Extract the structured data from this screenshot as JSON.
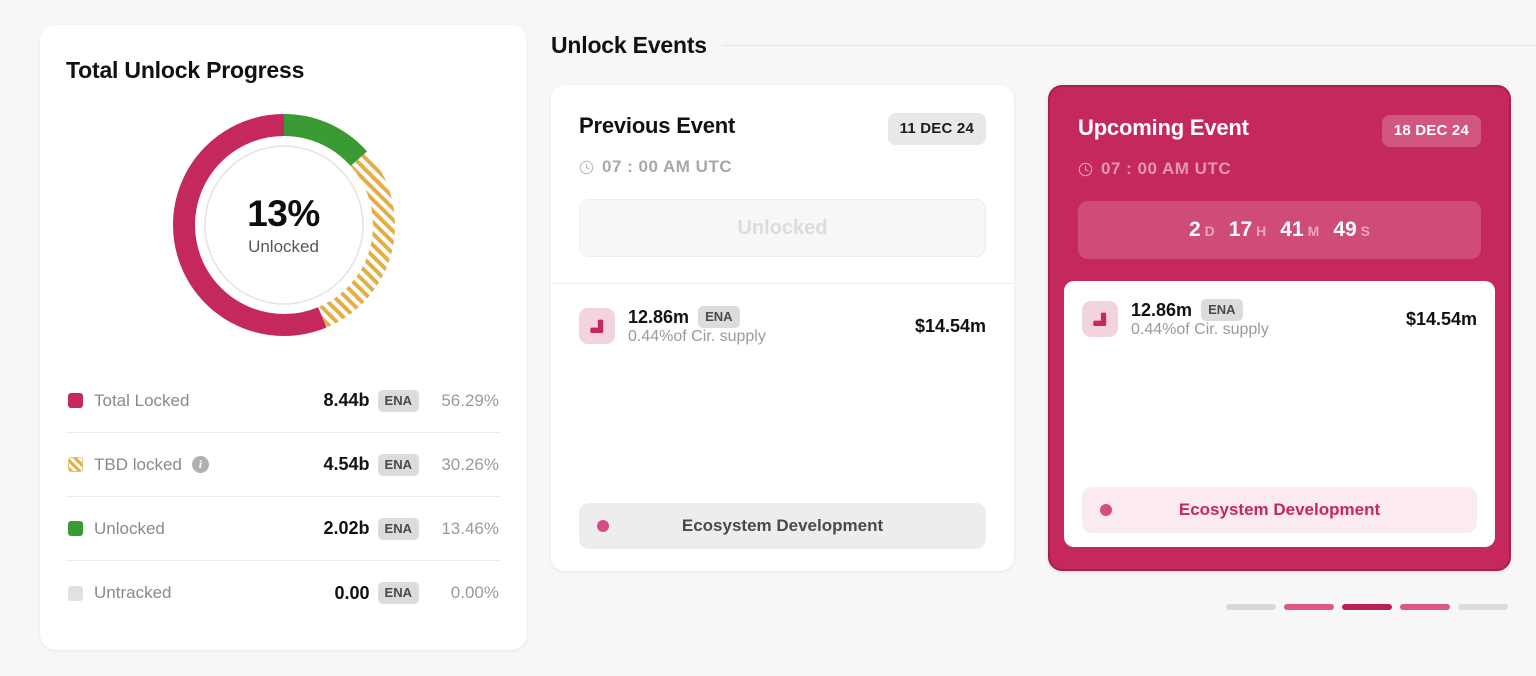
{
  "left_panel": {
    "title": "Total Unlock Progress",
    "donut": {
      "center_value": "13%",
      "center_label": "Unlocked"
    },
    "legend": [
      {
        "label": "Total Locked",
        "amount": "8.44b",
        "unit": "ENA",
        "percent": "56.29%",
        "swatch": "crimson-swatch",
        "has_info": false
      },
      {
        "label": "TBD locked",
        "amount": "4.54b",
        "unit": "ENA",
        "percent": "30.26%",
        "swatch": "striped-amber-swatch",
        "has_info": true
      },
      {
        "label": "Unlocked",
        "amount": "2.02b",
        "unit": "ENA",
        "percent": "13.46%",
        "swatch": "green-swatch",
        "has_info": false
      },
      {
        "label": "Untracked",
        "amount": "0.00",
        "unit": "ENA",
        "percent": "0.00%",
        "swatch": "grey-swatch",
        "has_info": false
      }
    ]
  },
  "unlock_events": {
    "section_title": "Unlock Events",
    "previous": {
      "title": "Previous Event",
      "date_badge": "11 DEC 24",
      "time": "07 : 00 AM UTC",
      "status": "Unlocked",
      "token": {
        "amount": "12.86m",
        "unit": "ENA",
        "sub": "0.44%of Cir. supply",
        "usd": "$14.54m"
      },
      "tag": "Ecosystem Development"
    },
    "upcoming": {
      "title": "Upcoming Event",
      "date_badge": "18 DEC 24",
      "time": "07 : 00 AM UTC",
      "countdown": {
        "days": "2",
        "days_unit": "D",
        "hours": "17",
        "hours_unit": "H",
        "minutes": "41",
        "minutes_unit": "M",
        "seconds": "49",
        "seconds_unit": "S"
      },
      "token": {
        "amount": "12.86m",
        "unit": "ENA",
        "sub": "0.44%of Cir. supply",
        "usd": "$14.54m"
      },
      "tag": "Ecosystem Development"
    }
  },
  "pagination": {
    "bars": [
      "#d8d8d8",
      "#e0587f",
      "#b8224f",
      "#e0587f",
      "#dcdcdc"
    ]
  },
  "chart_data": {
    "type": "pie",
    "title": "Total Unlock Progress",
    "categories": [
      "Total Locked",
      "TBD locked",
      "Unlocked",
      "Untracked"
    ],
    "values": [
      56.29,
      30.26,
      13.46,
      0.0
    ],
    "amounts": [
      "8.44b",
      "4.54b",
      "2.02b",
      "0.00"
    ],
    "unit": "ENA",
    "colors": [
      "#c4285c",
      "#e3ae46",
      "#3a9a34",
      "#e2e0e0"
    ],
    "center_label": "13% Unlocked",
    "legend_position": "below",
    "donut": true
  },
  "colors": {
    "crimson": "#c4285c",
    "crimson_dark": "#a81e4c",
    "green": "#3a9a34",
    "amber": "#e3ae46",
    "grey": "#e2e0e0",
    "page_bg": "#f7f7f7"
  }
}
